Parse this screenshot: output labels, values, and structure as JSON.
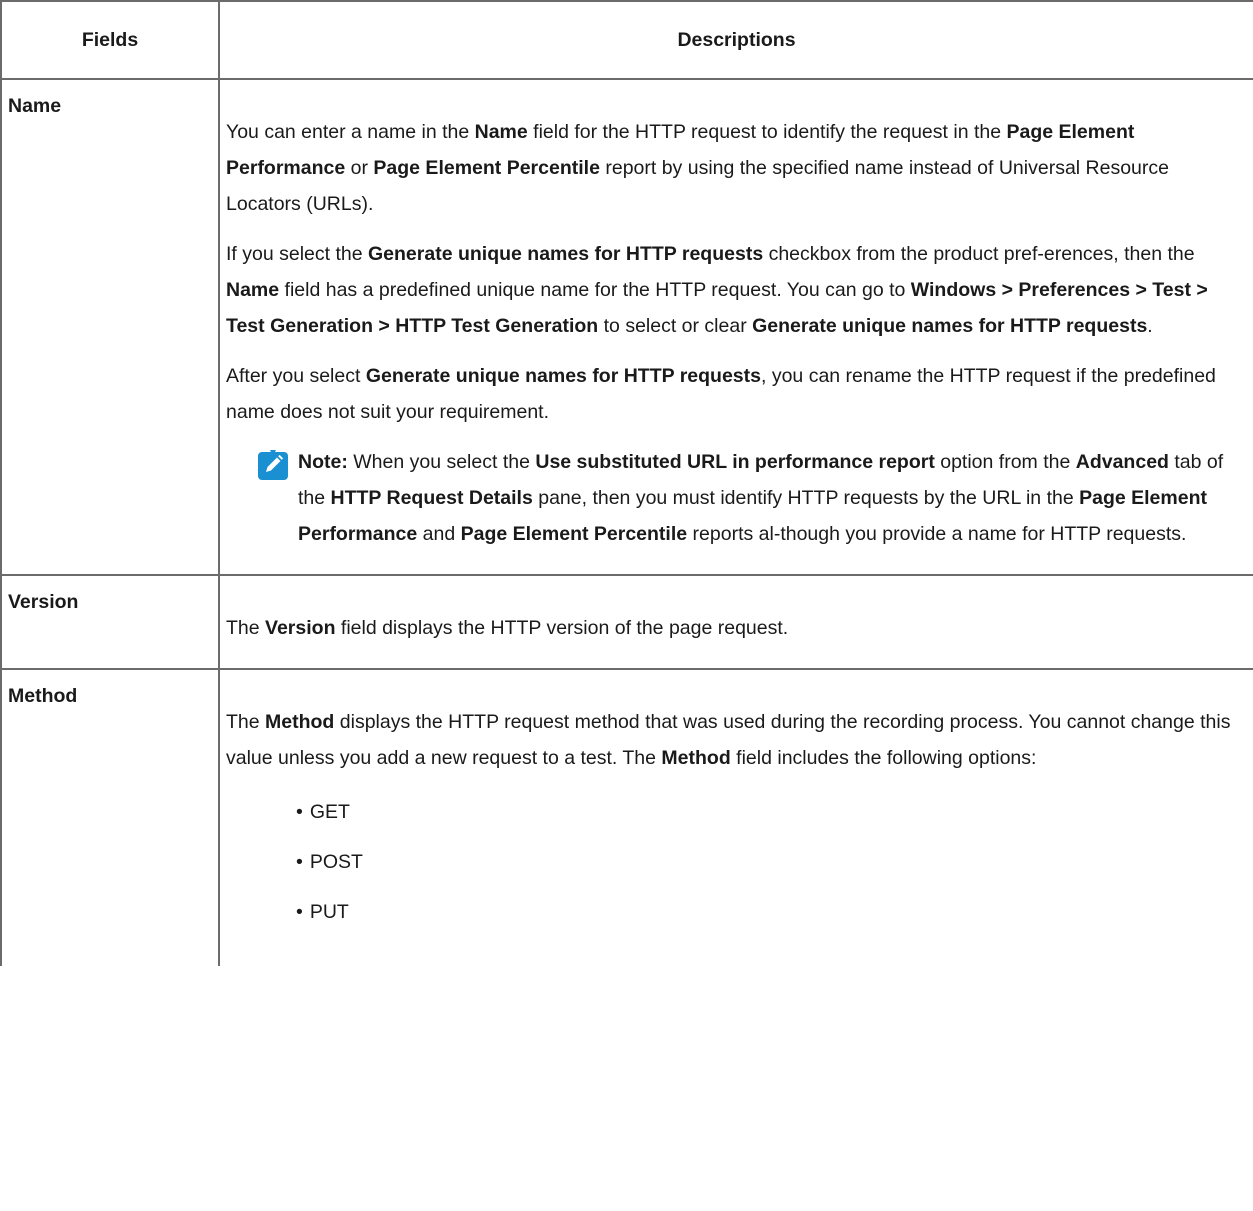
{
  "header": {
    "col1": "Fields",
    "col2": "Descriptions"
  },
  "name_row": {
    "field": "Name",
    "p1": {
      "t1": "You can enter a name in the ",
      "b1": "Name",
      "t2": " field for the HTTP request to identify the request in the ",
      "b2": "Page Element Performance",
      "t3": " or ",
      "b3": "Page Element Percentile",
      "t4": " report by using the specified name instead of Universal Resource Locators (URLs)."
    },
    "p2": {
      "t1": "If you select the ",
      "b1": "Generate unique names for HTTP requests",
      "t2": " checkbox from the product pref-erences, then the ",
      "b2": "Name",
      "t3": " field has a predefined unique name for the HTTP request. You can go to ",
      "b3": "Windows > Preferences > Test > Test Generation > HTTP Test Generation",
      "t4": " to select or clear ",
      "b4": "Generate unique names for HTTP requests",
      "t5": "."
    },
    "p3": {
      "t1": "After you select ",
      "b1": "Generate unique names for HTTP requests",
      "t2": ", you can rename the HTTP request if the predefined name does not suit your requirement."
    },
    "note": {
      "icon": "pencil-note-icon",
      "icon_color": "#1a8fd1",
      "label": "Note:",
      "t1": " When you select the ",
      "b1": "Use substituted URL in performance report",
      "t2": " option from the ",
      "b2": "Advanced",
      "t3": " tab of the ",
      "b3": "HTTP Request Details",
      "t4": " pane, then you must identify HTTP requests by the URL in the ",
      "b4": "Page Element Performance",
      "t5": " and ",
      "b5": "Page Element Percentile",
      "t6": " reports al-though you provide a name for HTTP requests."
    }
  },
  "version_row": {
    "field": "Version",
    "t1": "The ",
    "b1": "Version",
    "t2": " field displays the HTTP version of the page request."
  },
  "method_row": {
    "field": "Method",
    "t1": "The ",
    "b1": "Method",
    "t2": " displays the HTTP request method that was used during the recording process. You cannot change this value unless you add a new request to a test. The ",
    "b2": "Method",
    "t3": " field includes the following options:",
    "options": [
      "GET",
      "POST",
      "PUT"
    ]
  }
}
